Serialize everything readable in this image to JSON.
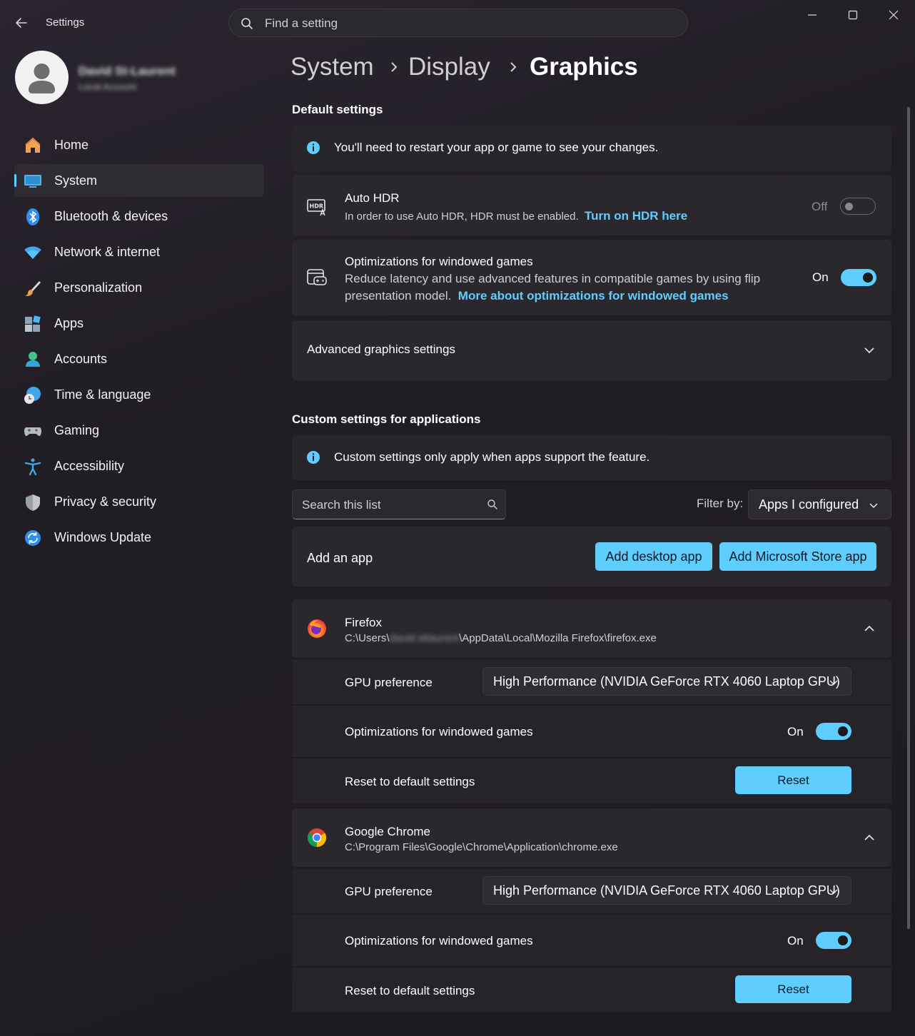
{
  "window": {
    "app_title": "Settings",
    "search_placeholder": "Find a setting"
  },
  "user": {
    "name": "David St-Laurent",
    "account_type": "Local Account"
  },
  "sidebar": {
    "items": [
      {
        "label": "Home",
        "icon": "home-icon"
      },
      {
        "label": "System",
        "icon": "system-icon",
        "selected": true
      },
      {
        "label": "Bluetooth & devices",
        "icon": "bluetooth-icon"
      },
      {
        "label": "Network & internet",
        "icon": "wifi-icon"
      },
      {
        "label": "Personalization",
        "icon": "brush-icon"
      },
      {
        "label": "Apps",
        "icon": "apps-icon"
      },
      {
        "label": "Accounts",
        "icon": "accounts-icon"
      },
      {
        "label": "Time & language",
        "icon": "globe-clock-icon"
      },
      {
        "label": "Gaming",
        "icon": "gamepad-icon"
      },
      {
        "label": "Accessibility",
        "icon": "accessibility-icon"
      },
      {
        "label": "Privacy & security",
        "icon": "shield-icon"
      },
      {
        "label": "Windows Update",
        "icon": "update-icon"
      }
    ]
  },
  "breadcrumb": [
    "System",
    "Display",
    "Graphics"
  ],
  "default_settings": {
    "title": "Default settings",
    "info": "You'll need to restart your app or game to see your changes.",
    "auto_hdr": {
      "title": "Auto HDR",
      "desc": "In order to use Auto HDR, HDR must be enabled.",
      "link": "Turn on HDR here",
      "state_label": "Off",
      "state": false
    },
    "windowed": {
      "title": "Optimizations for windowed games",
      "desc_line1": "Reduce latency and use advanced features in compatible games by using flip",
      "desc_line2": "presentation model.",
      "link": "More about optimizations for windowed games",
      "state_label": "On",
      "state": true
    },
    "advanced": "Advanced graphics settings"
  },
  "custom_settings": {
    "title": "Custom settings for applications",
    "info": "Custom settings only apply when apps support the feature.",
    "search_placeholder": "Search this list",
    "filter_label": "Filter by:",
    "filter_value": "Apps I configured",
    "add_app_label": "Add an app",
    "add_desktop_button": "Add desktop app",
    "add_store_button": "Add Microsoft Store app",
    "apps": [
      {
        "name": "Firefox",
        "path_prefix": "C:\\Users\\",
        "path_hidden": "david.stlaurent",
        "path_suffix": "\\AppData\\Local\\Mozilla Firefox\\firefox.exe",
        "gpu_label": "GPU preference",
        "gpu_value": "High Performance (NVIDIA GeForce RTX 4060 Laptop GPU)",
        "windowed_label": "Optimizations for windowed games",
        "windowed_state_label": "On",
        "reset_label": "Reset to default settings",
        "reset_button": "Reset"
      },
      {
        "name": "Google Chrome",
        "path": "C:\\Program Files\\Google\\Chrome\\Application\\chrome.exe",
        "gpu_label": "GPU preference",
        "gpu_value": "High Performance (NVIDIA GeForce RTX 4060 Laptop GPU)",
        "windowed_label": "Optimizations for windowed games",
        "windowed_state_label": "On",
        "reset_label": "Reset to default settings",
        "reset_button": "Reset"
      }
    ]
  },
  "colors": {
    "accent": "#60cdff",
    "background": "#201d22",
    "card": "#2a272d"
  }
}
